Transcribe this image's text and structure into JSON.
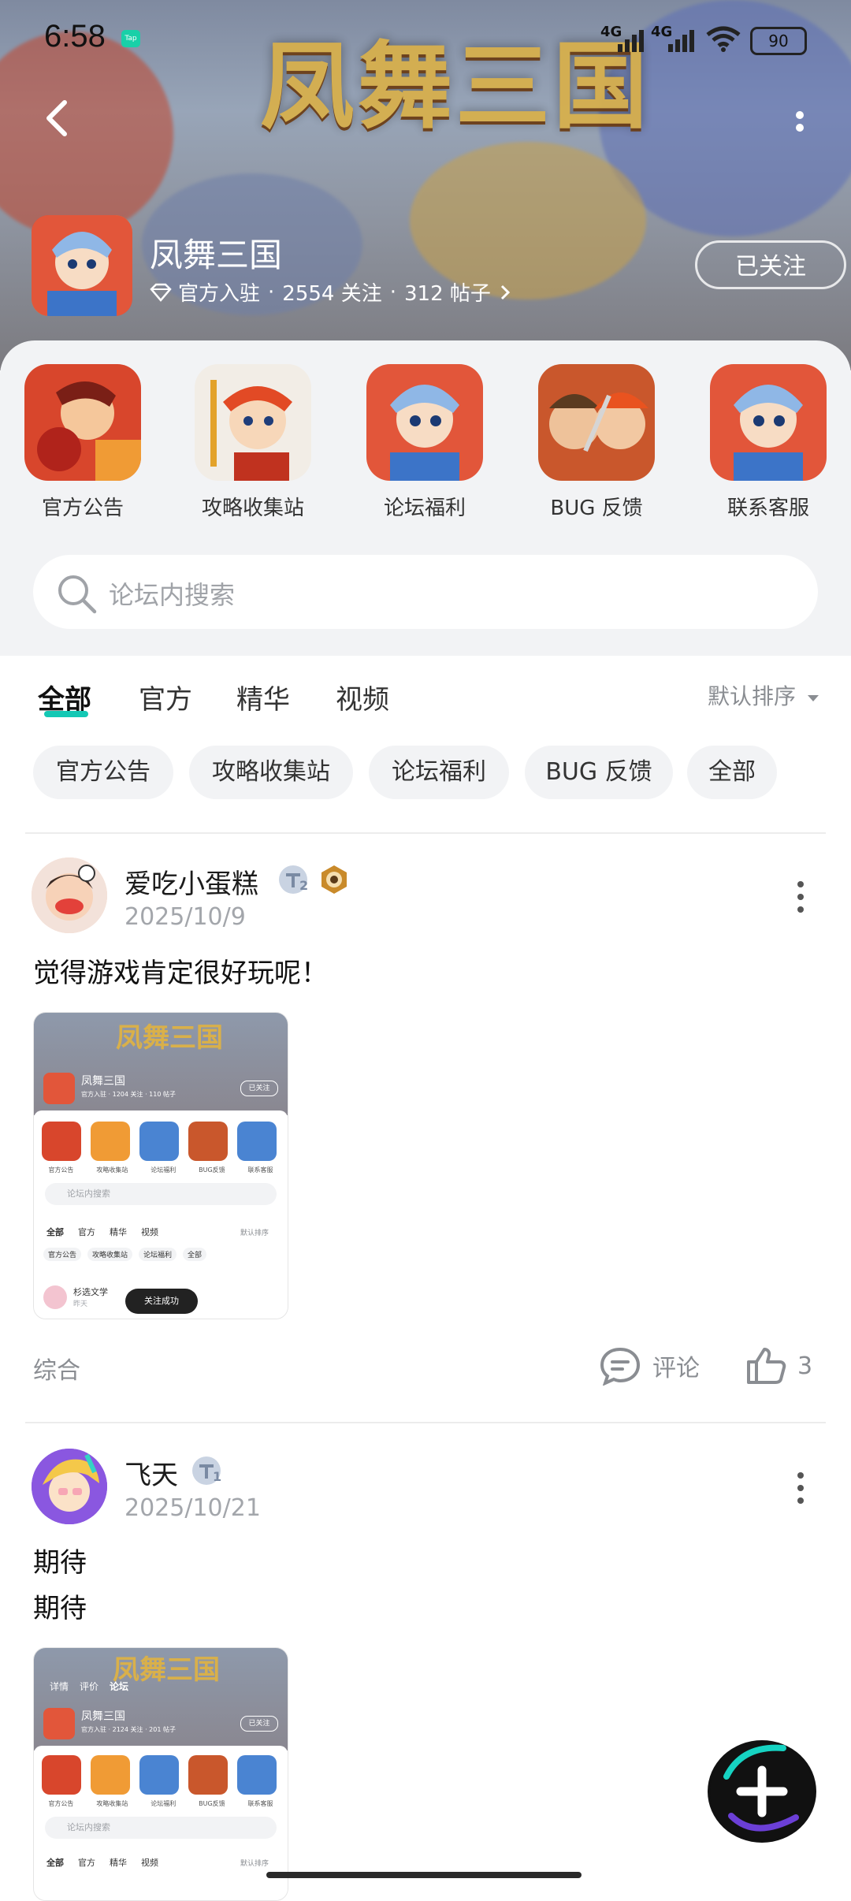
{
  "status_bar": {
    "time": "6:58",
    "app_badge": "Tap",
    "net1": "4G",
    "net2": "4G",
    "battery": "90"
  },
  "banner": {
    "title_art": "凤舞三国"
  },
  "forum": {
    "name": "凤舞三国",
    "official": "官方入驻",
    "follows": "2554 关注",
    "posts": "312 帖子",
    "sep": "·",
    "follow_label": "已关注"
  },
  "shortcuts": [
    {
      "label": "官方公告"
    },
    {
      "label": "攻略收集站"
    },
    {
      "label": "论坛福利"
    },
    {
      "label": "BUG 反馈"
    },
    {
      "label": "联系客服"
    }
  ],
  "search": {
    "placeholder": "论坛内搜索"
  },
  "tabs": [
    {
      "label": "全部",
      "active": true
    },
    {
      "label": "官方"
    },
    {
      "label": "精华"
    },
    {
      "label": "视频"
    }
  ],
  "sort": {
    "label": "默认排序"
  },
  "chips": [
    {
      "label": "官方公告"
    },
    {
      "label": "攻略收集站"
    },
    {
      "label": "论坛福利"
    },
    {
      "label": "BUG 反馈"
    },
    {
      "label": "全部"
    }
  ],
  "posts": [
    {
      "author": "爱吃小蛋糕",
      "date": "2025/10/9",
      "text": "觉得游戏肯定很好玩呢！",
      "level": "2",
      "category": "综合",
      "comment_label": "评论",
      "likes": "3",
      "thumb": {
        "title": "凤舞三国",
        "meta": "官方入驻 · 1204 关注 · 110 帖子",
        "follow": "已关注",
        "labels": [
          "官方公告",
          "攻略收集站",
          "论坛福利",
          "BUG反馈",
          "联系客服"
        ],
        "search": "论坛内搜索",
        "tabs": [
          "全部",
          "官方",
          "精华",
          "视频"
        ],
        "sort": "默认排序",
        "chips": [
          "官方公告",
          "攻略收集站",
          "论坛福利",
          "全部"
        ],
        "user": "杉选文学",
        "user_date": "昨天",
        "toast": "关注成功"
      }
    },
    {
      "author": "飞天",
      "date": "2025/10/21",
      "text_lines": [
        "期待",
        "期待"
      ],
      "level": "1",
      "thumb": {
        "nav": [
          "详情",
          "评价",
          "论坛"
        ],
        "title": "凤舞三国",
        "meta": "官方入驻 · 2124 关注 · 201 帖子",
        "follow": "已关注",
        "labels": [
          "官方公告",
          "攻略收集站",
          "论坛福利",
          "BUG反馈",
          "联系客服"
        ],
        "search": "论坛内搜索",
        "tabs": [
          "全部",
          "官方",
          "精华",
          "视频"
        ],
        "sort": "默认排序"
      }
    }
  ],
  "colors": {
    "accent": "#14c8b4",
    "panel_bg": "#f2f3f5",
    "muted": "#8a8d92"
  }
}
